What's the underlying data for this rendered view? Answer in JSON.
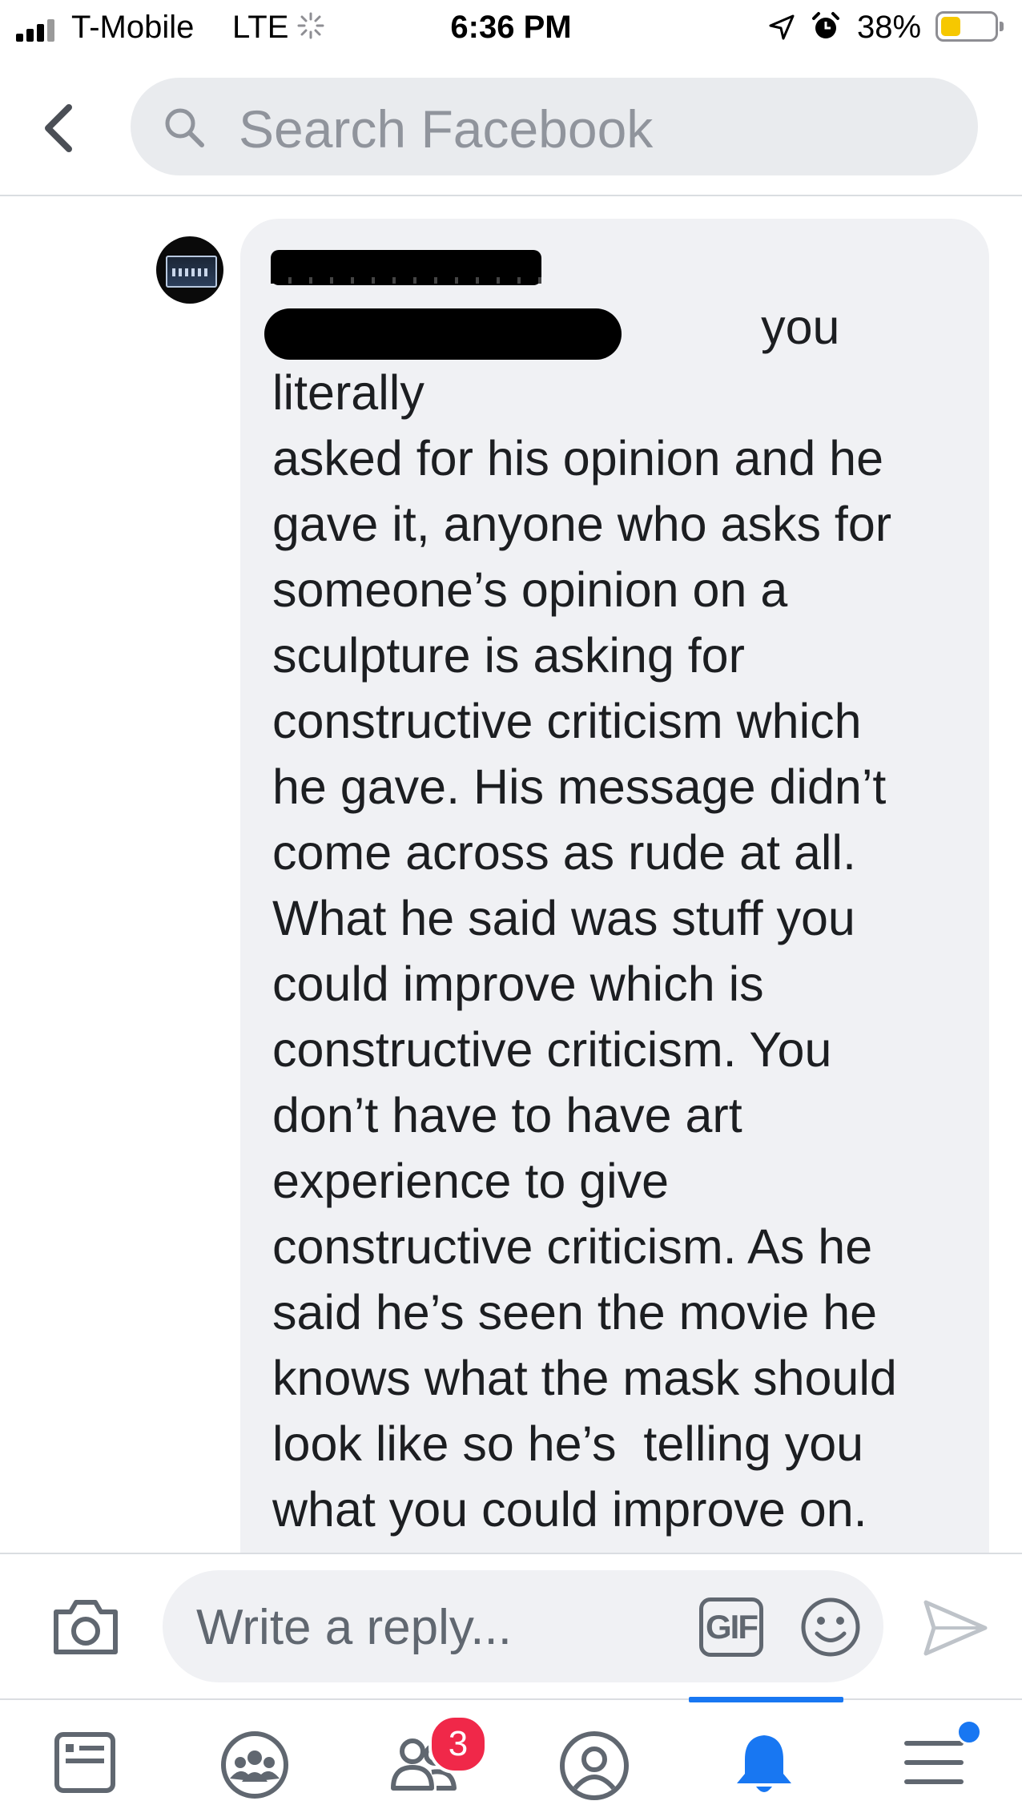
{
  "status_bar": {
    "carrier": "T-Mobile",
    "network": "LTE",
    "time": "6:36 PM",
    "battery_percent": "38%",
    "battery_level": 0.38
  },
  "header": {
    "search_placeholder": "Search Facebook",
    "back_icon": "chevron-left-icon",
    "search_icon": "magnifier-icon"
  },
  "comment": {
    "author_redacted": true,
    "mention_redacted": true,
    "text": "                                    you literally\nasked for his opinion and he\ngave it, anyone who asks for\nsomeone’s opinion on a\nsculpture is asking for\nconstructive criticism which\nhe gave. His message didn’t\ncome across as rude at all.\nWhat he said was stuff you\ncould improve which is\nconstructive criticism. You\ndon’t have to have art\nexperience to give\nconstructive criticism. As he\nsaid he’s seen the movie he\nknows what the mask should\nlook like so he’s  telling you\nwhat you could improve on.\nYou’re just to fuckin sensitive"
  },
  "reply_bar": {
    "placeholder": "Write a reply...",
    "gif_label": "GIF",
    "icons": [
      "camera-icon",
      "gif-icon",
      "emoji-icon",
      "send-icon"
    ]
  },
  "tab_bar": {
    "tabs": [
      {
        "name": "news-feed",
        "icon": "news-feed-icon",
        "active": false
      },
      {
        "name": "groups",
        "icon": "groups-icon",
        "active": false
      },
      {
        "name": "friend-requests",
        "icon": "friends-icon",
        "active": false,
        "badge": "3"
      },
      {
        "name": "profile",
        "icon": "profile-icon",
        "active": false
      },
      {
        "name": "notifications",
        "icon": "bell-icon",
        "active": true
      },
      {
        "name": "menu",
        "icon": "hamburger-icon",
        "active": false
      }
    ],
    "friend_requests_badge": "3",
    "active_color": "#1877f2"
  },
  "colors": {
    "accent": "#1877f2",
    "bubble_bg": "#f0f1f4",
    "search_bg": "#e9ebee",
    "badge": "#f02849",
    "battery_fill": "#f6c800"
  }
}
